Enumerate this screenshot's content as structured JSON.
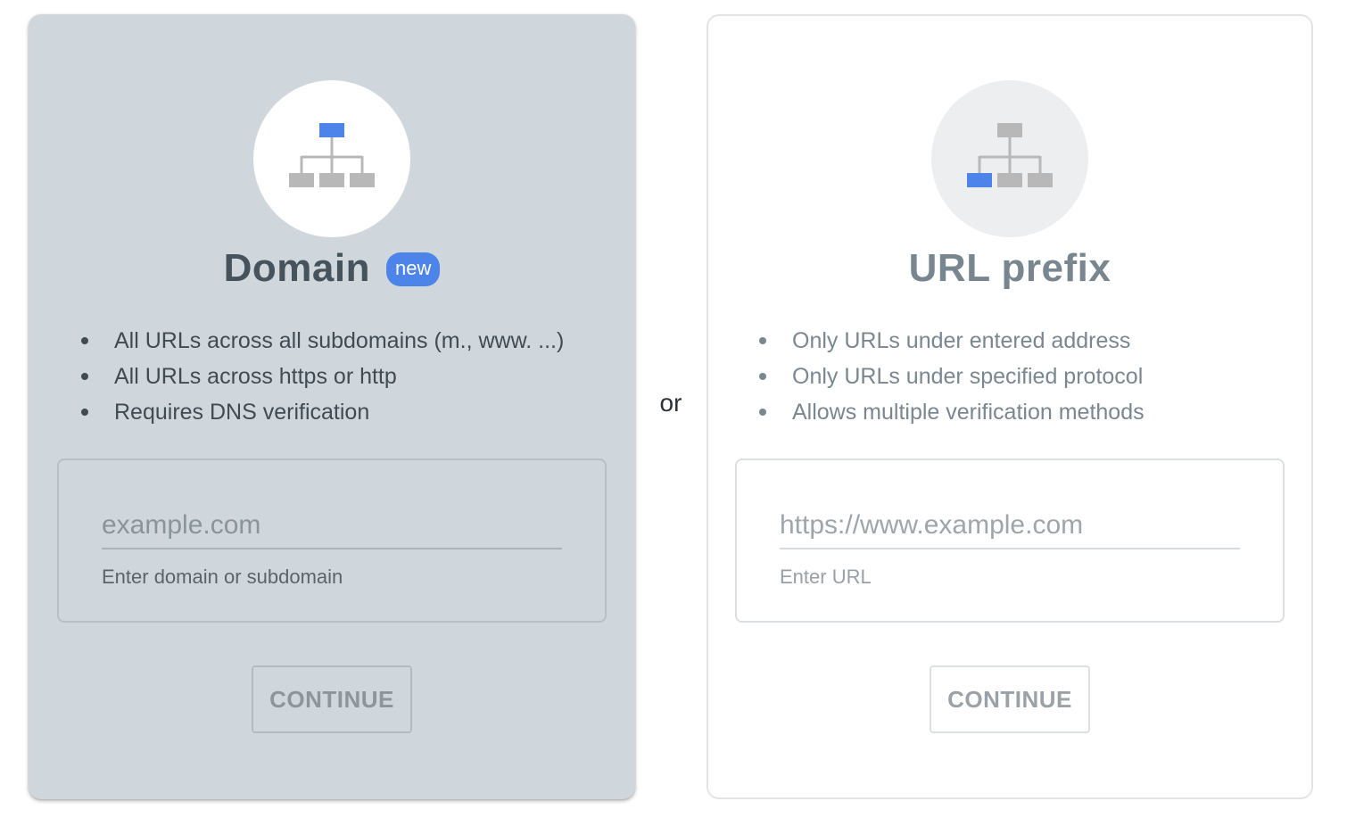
{
  "domain_card": {
    "title": "Domain",
    "badge": "new",
    "features": [
      "All URLs across all subdomains (m., www. ...)",
      "All URLs across https or http",
      "Requires DNS verification"
    ],
    "input": {
      "value": "",
      "placeholder": "example.com",
      "helper": "Enter domain or subdomain"
    },
    "continue_label": "CONTINUE",
    "icon": "sitemap-icon-root-highlighted"
  },
  "separator": "or",
  "prefix_card": {
    "title": "URL prefix",
    "features": [
      "Only URLs under entered address",
      "Only URLs under specified protocol",
      "Allows multiple verification methods"
    ],
    "input": {
      "value": "",
      "placeholder": "https://www.example.com",
      "helper": "Enter URL"
    },
    "continue_label": "CONTINUE",
    "icon": "sitemap-icon-leaf-highlighted"
  },
  "colors": {
    "accent_blue": "#4c84ea",
    "icon_gray": "#b8b8b8",
    "selected_card_bg": "#d0d7dc"
  }
}
